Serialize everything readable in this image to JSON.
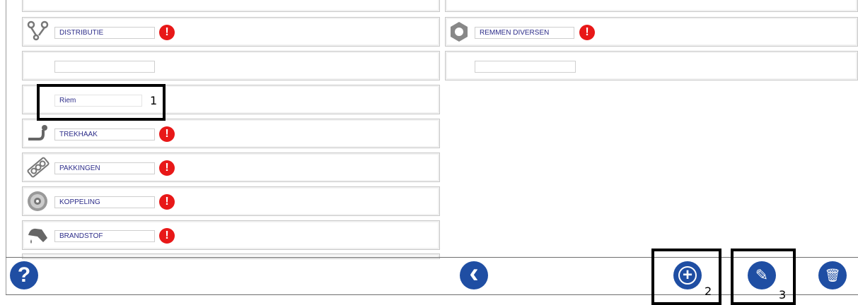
{
  "categories_left": {
    "distributie": "DISTRIBUTIE",
    "empty": "",
    "riem": "Riem",
    "trekhaak": "TREKHAAK",
    "pakkingen": "PAKKINGEN",
    "koppeling": "KOPPELING",
    "brandstof": "BRANDSTOF"
  },
  "categories_right": {
    "remmen_diversen": "REMMEN DIVERSEN",
    "empty": ""
  },
  "warning_glyph": "!",
  "annotations": {
    "a1": "1",
    "a2": "2",
    "a3": "3"
  },
  "footer": {
    "help_glyph": "?",
    "back_glyph": "‹",
    "add_glyph": "+",
    "pin_glyph": "✎",
    "trash_glyph": "🗑"
  },
  "colors": {
    "button_blue": "#1f4ea3",
    "warning_red": "#e81818",
    "field_text": "#2e2e8a"
  }
}
